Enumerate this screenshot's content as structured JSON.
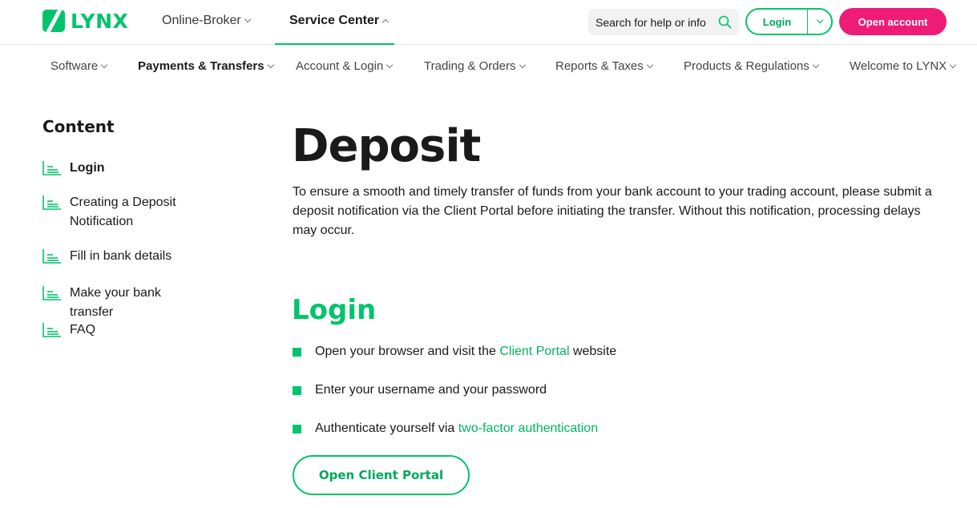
{
  "brand": {
    "name": "LYNX",
    "color": "#00c46c"
  },
  "topnav": [
    {
      "label": "Online-Broker",
      "chevron": "down",
      "active": false
    },
    {
      "label": "Service Center",
      "chevron": "up",
      "active": true
    }
  ],
  "search": {
    "placeholder": "Search for help or info",
    "icon": "search-icon"
  },
  "header_actions": {
    "login_label": "Login",
    "open_account_label": "Open account",
    "accent": "#ee1c76"
  },
  "subnav": [
    {
      "label": "Software",
      "active": false
    },
    {
      "label": "Payments & Transfers",
      "active": true
    },
    {
      "label": "Account & Login",
      "active": false
    },
    {
      "label": "Trading & Orders",
      "active": false
    },
    {
      "label": "Reports & Taxes",
      "active": false
    },
    {
      "label": "Products & Regulations",
      "active": false
    },
    {
      "label": "Welcome to LYNX",
      "active": false
    }
  ],
  "sidebar": {
    "title": "Content",
    "items": [
      {
        "label": "Login",
        "active": true
      },
      {
        "label": "Creating a Deposit Notification",
        "active": false
      },
      {
        "label": "Fill in bank details",
        "active": false
      },
      {
        "label": "Make your bank transfer",
        "active": false
      },
      {
        "label": "FAQ",
        "active": false
      }
    ]
  },
  "main": {
    "title": "Deposit",
    "intro": "To ensure a smooth and timely transfer of funds from your bank account to your trading account, please submit a deposit notification via the Client Portal before initiating the transfer. Without this notification, processing delays may occur.",
    "section_title": "Login",
    "steps": [
      {
        "before": "Open your browser and visit the ",
        "link": "Client Portal",
        "after": " website"
      },
      {
        "before": "Enter your username and your password",
        "link": "",
        "after": ""
      },
      {
        "before": "Authenticate yourself via ",
        "link": "two-factor authentication",
        "after": ""
      }
    ],
    "cta_label": "Open Client Portal"
  }
}
